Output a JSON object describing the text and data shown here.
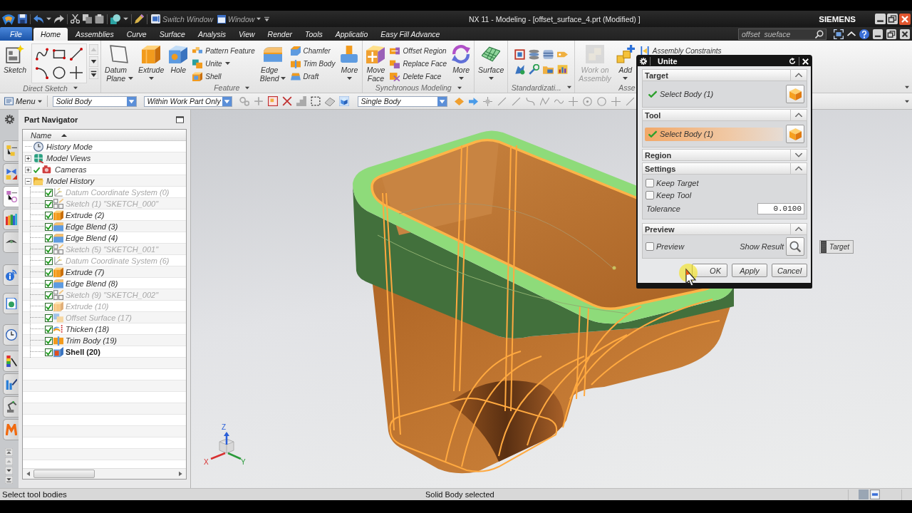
{
  "title_bar": {
    "switch_window": "Switch Window",
    "window_menu": "Window",
    "title": "NX 11 - Modeling - [offset_surface_4.prt (Modified) ]",
    "brand": "SIEMENS"
  },
  "tabs": [
    {
      "label": "File",
      "kind": "file",
      "selected": false
    },
    {
      "label": "Home",
      "kind": "tab",
      "selected": true
    },
    {
      "label": "Assemblies",
      "kind": "tab",
      "selected": false
    },
    {
      "label": "Curve",
      "kind": "tab",
      "selected": false
    },
    {
      "label": "Surface",
      "kind": "tab",
      "selected": false
    },
    {
      "label": "Analysis",
      "kind": "tab",
      "selected": false
    },
    {
      "label": "View",
      "kind": "tab",
      "selected": false
    },
    {
      "label": "Render",
      "kind": "tab",
      "selected": false
    },
    {
      "label": "Tools",
      "kind": "tab",
      "selected": false
    },
    {
      "label": "Applicatio",
      "kind": "tab",
      "selected": false
    },
    {
      "label": "Easy Fill Advance",
      "kind": "tab",
      "selected": false
    }
  ],
  "search": {
    "value": "offset  sueface"
  },
  "ribbon": [
    {
      "label": "Direct Sketch",
      "items": [
        {
          "kind": "large",
          "label": "Sketch",
          "menu": false,
          "disabled": false
        },
        {
          "kind": "palette"
        }
      ]
    },
    {
      "label": "Feature",
      "items": [
        {
          "kind": "large",
          "label": "Datum Plane",
          "menu": true,
          "disabled": false
        },
        {
          "kind": "large",
          "label": "Extrude",
          "menu": true,
          "disabled": false
        },
        {
          "kind": "large",
          "label": "Hole",
          "menu": false,
          "disabled": false
        },
        {
          "kind": "stack",
          "entries": [
            {
              "label": "Pattern Feature",
              "menu": false,
              "disabled": false
            },
            {
              "label": "Unite",
              "menu": true,
              "disabled": false
            },
            {
              "label": "Shell",
              "menu": false,
              "disabled": false
            }
          ]
        },
        {
          "kind": "large",
          "label": "Edge Blend",
          "menu": true,
          "disabled": false
        },
        {
          "kind": "stack",
          "entries": [
            {
              "label": "Chamfer",
              "menu": false,
              "disabled": false
            },
            {
              "label": "Trim Body",
              "menu": false,
              "disabled": false
            },
            {
              "label": "Draft",
              "menu": false,
              "disabled": false
            }
          ]
        },
        {
          "kind": "large",
          "label": "More",
          "menu": true,
          "disabled": false
        }
      ]
    },
    {
      "label": "Synchronous Modeling",
      "items": [
        {
          "kind": "large",
          "label": "Move Face",
          "menu": false,
          "disabled": false
        },
        {
          "kind": "stack",
          "entries": [
            {
              "label": "Offset Region",
              "menu": false,
              "disabled": false
            },
            {
              "label": "Replace Face",
              "menu": false,
              "disabled": false
            },
            {
              "label": "Delete Face",
              "menu": false,
              "disabled": false
            }
          ]
        },
        {
          "kind": "large",
          "label": "More",
          "menu": true,
          "disabled": false
        }
      ]
    },
    {
      "items": [
        {
          "kind": "large",
          "label": "Surface",
          "menu": true,
          "disabled": false
        }
      ]
    },
    {
      "label": "Standardizati...",
      "items": [
        {
          "kind": "grid"
        }
      ]
    },
    {
      "label": "Asse",
      "items": [
        {
          "kind": "large",
          "label": "Work on Assembly",
          "menu": false,
          "disabled": true
        },
        {
          "kind": "large",
          "label": "Add",
          "menu": true,
          "disabled": false
        },
        {
          "kind": "stack",
          "entries": [
            {
              "label": "Assembly Constraints",
              "menu": false,
              "disabled": false
            }
          ]
        }
      ]
    }
  ],
  "selection_bar": {
    "menu": "Menu",
    "filters": [
      "Solid Body",
      "Within Work Part Only",
      "Single Body"
    ]
  },
  "resource_bar": [
    {
      "selected": false
    },
    {
      "selected": false
    },
    {
      "selected": true
    },
    {
      "selected": false
    },
    {
      "selected": false
    },
    {
      "selected": false
    },
    {
      "selected": false
    },
    {
      "selected": false
    },
    {
      "selected": false
    },
    {
      "selected": false
    },
    {
      "selected": false
    },
    {
      "selected": false
    }
  ],
  "part_navigator": {
    "title": "Part Navigator",
    "column": "Name",
    "items": [
      {
        "label": "History Mode",
        "kind": "history",
        "checked": false
      },
      {
        "label": "Model Views",
        "kind": "views",
        "expanded": false,
        "checked": false
      },
      {
        "label": "Cameras",
        "kind": "cameras",
        "expanded": false,
        "checked": true
      },
      {
        "label": "Model History",
        "kind": "folder",
        "expanded": true,
        "checked": false,
        "children": [
          {
            "label": "Datum Coordinate System (0)",
            "kind": "datum",
            "checked": true,
            "dimmed": true,
            "current": false
          },
          {
            "label": "Sketch (1) \"SKETCH_000\"",
            "kind": "sketch",
            "checked": true,
            "dimmed": true,
            "current": false
          },
          {
            "label": "Extrude (2)",
            "kind": "extrude",
            "checked": true,
            "dimmed": false,
            "current": false
          },
          {
            "label": "Edge Blend (3)",
            "kind": "blend",
            "checked": true,
            "dimmed": false,
            "current": false
          },
          {
            "label": "Edge Blend (4)",
            "kind": "blend",
            "checked": true,
            "dimmed": false,
            "current": false
          },
          {
            "label": "Sketch (5) \"SKETCH_001\"",
            "kind": "sketch",
            "checked": true,
            "dimmed": true,
            "current": false
          },
          {
            "label": "Datum Coordinate System (6)",
            "kind": "datum",
            "checked": true,
            "dimmed": true,
            "current": false
          },
          {
            "label": "Extrude (7)",
            "kind": "extrude",
            "checked": true,
            "dimmed": false,
            "current": false
          },
          {
            "label": "Edge Blend (8)",
            "kind": "blend",
            "checked": true,
            "dimmed": false,
            "current": false
          },
          {
            "label": "Sketch (9) \"SKETCH_002\"",
            "kind": "sketch",
            "checked": true,
            "dimmed": true,
            "current": false
          },
          {
            "label": "Extrude (10)",
            "kind": "extrude",
            "checked": true,
            "dimmed": true,
            "current": false
          },
          {
            "label": "Offset Surface (17)",
            "kind": "offset",
            "checked": true,
            "dimmed": true,
            "current": false
          },
          {
            "label": "Thicken (18)",
            "kind": "thicken",
            "checked": true,
            "dimmed": false,
            "current": false
          },
          {
            "label": "Trim Body (19)",
            "kind": "trim",
            "checked": true,
            "dimmed": false,
            "current": false
          },
          {
            "label": "Shell (20)",
            "kind": "shell",
            "checked": true,
            "dimmed": false,
            "current": true
          }
        ]
      }
    ]
  },
  "viewport": {
    "triad": [
      "X",
      "Y",
      "Z"
    ],
    "tag": "Target"
  },
  "dialog": {
    "title": "Unite",
    "sections": [
      {
        "title": "Target",
        "expanded": true,
        "rows": [
          {
            "kind": "selection",
            "label": "Select Body (1)",
            "complete": true,
            "active": false
          }
        ]
      },
      {
        "title": "Tool",
        "expanded": true,
        "rows": [
          {
            "kind": "selection",
            "label": "Select Body (1)",
            "complete": true,
            "active": true
          }
        ]
      },
      {
        "title": "Region",
        "expanded": false
      },
      {
        "title": "Settings",
        "expanded": true,
        "rows": [
          {
            "kind": "checkbox",
            "label": "Keep Target",
            "checked": false
          },
          {
            "kind": "checkbox",
            "label": "Keep Tool",
            "checked": false
          },
          {
            "kind": "number",
            "label": "Tolerance",
            "value": "0.0100"
          }
        ]
      },
      {
        "title": "Preview",
        "expanded": true,
        "rows": [
          {
            "kind": "preview",
            "label": "Preview",
            "checked": false,
            "action": "Show Result"
          }
        ]
      }
    ],
    "buttons": [
      "OK",
      "Apply",
      "Cancel"
    ]
  },
  "status_bar": {
    "prompt": "Select tool bodies",
    "message": "Solid Body selected"
  }
}
